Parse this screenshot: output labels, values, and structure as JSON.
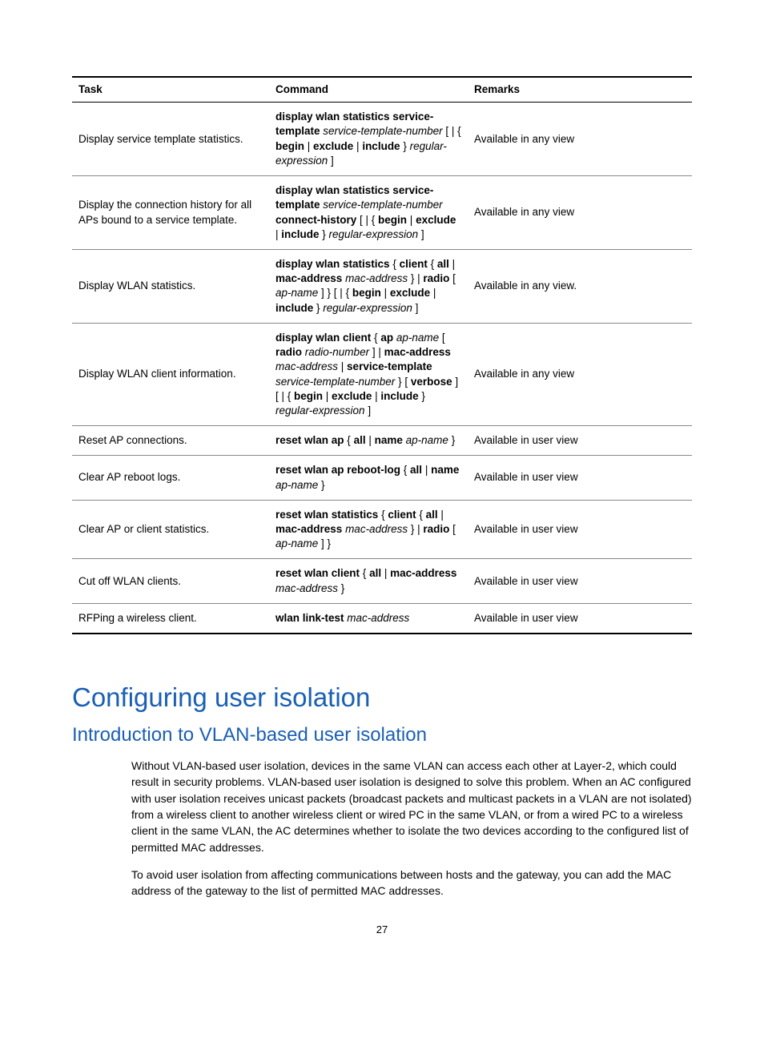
{
  "table": {
    "headers": {
      "task": "Task",
      "command": "Command",
      "remarks": "Remarks"
    },
    "rows": [
      {
        "task": "Display service template statistics.",
        "cmd": [
          {
            "t": "display wlan statistics service-template",
            "c": "b"
          },
          {
            "t": " "
          },
          {
            "t": "service-template-number",
            "c": "i"
          },
          {
            "t": " [ | { "
          },
          {
            "t": "begin",
            "c": "b"
          },
          {
            "t": " | "
          },
          {
            "t": "exclude",
            "c": "b"
          },
          {
            "t": " | "
          },
          {
            "t": "include",
            "c": "b"
          },
          {
            "t": " } "
          },
          {
            "t": "regular-expression",
            "c": "i"
          },
          {
            "t": " ]"
          }
        ],
        "remarks": "Available in any view"
      },
      {
        "task": "Display the connection history for all APs bound to a service template.",
        "cmd": [
          {
            "t": "display wlan statistics service-template",
            "c": "b"
          },
          {
            "t": " "
          },
          {
            "t": "service-template-number",
            "c": "i"
          },
          {
            "t": " "
          },
          {
            "t": "connect-history",
            "c": "b"
          },
          {
            "t": " [ | { "
          },
          {
            "t": "begin",
            "c": "b"
          },
          {
            "t": " | "
          },
          {
            "t": "exclude",
            "c": "b"
          },
          {
            "t": " | "
          },
          {
            "t": "include",
            "c": "b"
          },
          {
            "t": " } "
          },
          {
            "t": "regular-expression",
            "c": "i"
          },
          {
            "t": " ]"
          }
        ],
        "remarks": "Available in any view"
      },
      {
        "task": "Display WLAN statistics.",
        "cmd": [
          {
            "t": "display wlan statistics",
            "c": "b"
          },
          {
            "t": " { "
          },
          {
            "t": "client",
            "c": "b"
          },
          {
            "t": " { "
          },
          {
            "t": "all",
            "c": "b"
          },
          {
            "t": " | "
          },
          {
            "t": "mac-address",
            "c": "b"
          },
          {
            "t": " "
          },
          {
            "t": "mac-address",
            "c": "i"
          },
          {
            "t": " } | "
          },
          {
            "t": "radio",
            "c": "b"
          },
          {
            "t": " [ "
          },
          {
            "t": "ap-name",
            "c": "i"
          },
          {
            "t": " ] } [ | { "
          },
          {
            "t": "begin",
            "c": "b"
          },
          {
            "t": " | "
          },
          {
            "t": "exclude",
            "c": "b"
          },
          {
            "t": " | "
          },
          {
            "t": "include",
            "c": "b"
          },
          {
            "t": " } "
          },
          {
            "t": "regular-expression",
            "c": "i"
          },
          {
            "t": " ]"
          }
        ],
        "remarks": "Available in any view."
      },
      {
        "task": "Display WLAN client information.",
        "cmd": [
          {
            "t": "display wlan client",
            "c": "b"
          },
          {
            "t": " { "
          },
          {
            "t": "ap",
            "c": "b"
          },
          {
            "t": " "
          },
          {
            "t": "ap-name",
            "c": "i"
          },
          {
            "t": " [ "
          },
          {
            "t": "radio",
            "c": "b"
          },
          {
            "t": " "
          },
          {
            "t": "radio-number",
            "c": "i"
          },
          {
            "t": " ] | "
          },
          {
            "t": "mac-address",
            "c": "b"
          },
          {
            "t": " "
          },
          {
            "t": "mac-address",
            "c": "i"
          },
          {
            "t": " | "
          },
          {
            "t": "service-template",
            "c": "b"
          },
          {
            "t": " "
          },
          {
            "t": "service-template-number",
            "c": "i"
          },
          {
            "t": " } [ "
          },
          {
            "t": "verbose",
            "c": "b"
          },
          {
            "t": " ] [ | { "
          },
          {
            "t": "begin",
            "c": "b"
          },
          {
            "t": " | "
          },
          {
            "t": "exclude",
            "c": "b"
          },
          {
            "t": " | "
          },
          {
            "t": "include",
            "c": "b"
          },
          {
            "t": " } "
          },
          {
            "t": "regular-expression",
            "c": "i"
          },
          {
            "t": " ]"
          }
        ],
        "remarks": "Available in any view"
      },
      {
        "task": "Reset AP connections.",
        "cmd": [
          {
            "t": "reset wlan ap",
            "c": "b"
          },
          {
            "t": " { "
          },
          {
            "t": "all",
            "c": "b"
          },
          {
            "t": " | "
          },
          {
            "t": "name",
            "c": "b"
          },
          {
            "t": " "
          },
          {
            "t": "ap-name",
            "c": "i"
          },
          {
            "t": " }"
          }
        ],
        "remarks": "Available in user view"
      },
      {
        "task": "Clear AP reboot logs.",
        "cmd": [
          {
            "t": "reset wlan ap reboot-log",
            "c": "b"
          },
          {
            "t": " { "
          },
          {
            "t": "all",
            "c": "b"
          },
          {
            "t": " | "
          },
          {
            "t": "name",
            "c": "b"
          },
          {
            "t": " "
          },
          {
            "t": "ap-name",
            "c": "i"
          },
          {
            "t": " }"
          }
        ],
        "remarks": "Available in user view"
      },
      {
        "task": "Clear AP or client statistics.",
        "cmd": [
          {
            "t": "reset wlan statistics",
            "c": "b"
          },
          {
            "t": " { "
          },
          {
            "t": "client",
            "c": "b"
          },
          {
            "t": " { "
          },
          {
            "t": "all",
            "c": "b"
          },
          {
            "t": " | "
          },
          {
            "t": "mac-address",
            "c": "b"
          },
          {
            "t": " "
          },
          {
            "t": "mac-address",
            "c": "i"
          },
          {
            "t": " } | "
          },
          {
            "t": "radio",
            "c": "b"
          },
          {
            "t": " [ "
          },
          {
            "t": "ap-name",
            "c": "i"
          },
          {
            "t": " ] }"
          }
        ],
        "remarks": "Available in user view"
      },
      {
        "task": "Cut off WLAN clients.",
        "cmd": [
          {
            "t": "reset wlan client",
            "c": "b"
          },
          {
            "t": " { "
          },
          {
            "t": "all",
            "c": "b"
          },
          {
            "t": " | "
          },
          {
            "t": "mac-address",
            "c": "b"
          },
          {
            "t": " "
          },
          {
            "t": "mac-address",
            "c": "i"
          },
          {
            "t": " }"
          }
        ],
        "remarks": "Available in user view"
      },
      {
        "task": "RFPing a wireless client.",
        "cmd": [
          {
            "t": "wlan link-test",
            "c": "b"
          },
          {
            "t": " "
          },
          {
            "t": "mac-address",
            "c": "i"
          }
        ],
        "remarks": "Available in user view"
      }
    ]
  },
  "headings": {
    "h1": "Configuring user isolation",
    "h2": "Introduction to VLAN-based user isolation"
  },
  "paragraphs": {
    "p1": "Without VLAN-based user isolation, devices in the same VLAN can access each other at Layer-2, which could result in security problems. VLAN-based user isolation is designed to solve this problem. When an AC configured with user isolation receives unicast packets (broadcast packets and multicast packets in a VLAN are not isolated) from a wireless client to another wireless client or wired PC in the same VLAN, or from a wired PC to a wireless client in the same VLAN, the AC determines whether to isolate the two devices according to the configured list of permitted MAC addresses.",
    "p2": "To avoid user isolation from affecting communications between hosts and the gateway, you can add the MAC address of the gateway to the list of permitted MAC addresses."
  },
  "page_number": "27"
}
